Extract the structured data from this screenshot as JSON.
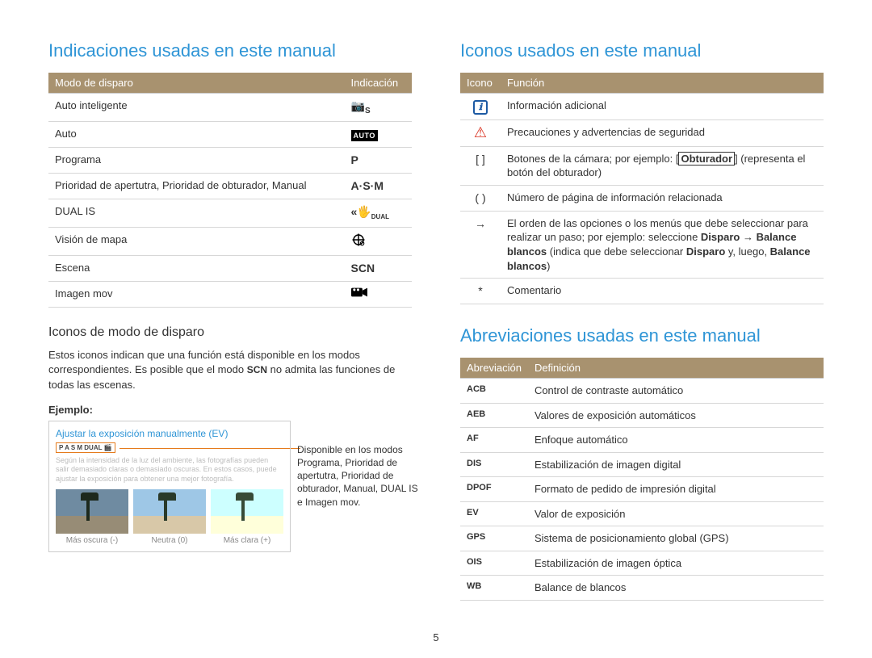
{
  "page_number": "5",
  "left": {
    "heading": "Indicaciones usadas en este manual",
    "table": {
      "header": [
        "Modo de disparo",
        "Indicación"
      ],
      "rows": [
        {
          "mode": "Auto inteligente",
          "ind": "S",
          "style": "smart"
        },
        {
          "mode": "Auto",
          "ind": "AUTO",
          "style": "autobox"
        },
        {
          "mode": "Programa",
          "ind": "P",
          "style": "plain"
        },
        {
          "mode": "Prioridad de apertutra, Prioridad de obturador, Manual",
          "ind": "A·S·M",
          "style": "plain"
        },
        {
          "mode": "DUAL IS",
          "ind": "DUAL",
          "style": "dual"
        },
        {
          "mode": "Visión de mapa",
          "ind": "⊕",
          "style": "plain"
        },
        {
          "mode": "Escena",
          "ind": "SCN",
          "style": "plain"
        },
        {
          "mode": "Imagen mov",
          "ind": "🎬",
          "style": "plain"
        }
      ]
    },
    "sub_heading": "Iconos de modo de disparo",
    "body_before_scn": "Estos iconos indican que una función está disponible en los modos correspondientes. Es posible que el modo ",
    "scn_inline": "SCN",
    "body_after_scn": " no admita las funciones de todas las escenas.",
    "ejemplo_label": "Ejemplo:",
    "example": {
      "title": "Ajustar la exposición manualmente (EV)",
      "mode_strip": "P A S M DUAL 🎬",
      "blurred_text": "Según la intensidad de la luz del ambiente, las fotografías pueden salir demasiado claras o demasiado oscuras. En estos casos, puede ajustar la exposición para obtener una mejor fotografía.",
      "thumbs": [
        "Más oscura (-)",
        "Neutra (0)",
        "Más clara (+)"
      ],
      "callout": "Disponible en los modos Programa, Prioridad de apertutra, Prioridad de obturador, Manual, DUAL IS e Imagen mov."
    }
  },
  "right": {
    "icons_heading": "Iconos usados en este manual",
    "icons_table": {
      "header": [
        "Icono",
        "Función"
      ],
      "rows": [
        {
          "icon": "info",
          "func": "Información adicional"
        },
        {
          "icon": "warn",
          "func": "Precauciones y advertencias de seguridad"
        },
        {
          "icon": "[ ]",
          "func_html": "Botones de la cámara; por ejemplo: [<b>Obturador</b>] (representa el botón del obturador)"
        },
        {
          "icon": "( )",
          "func": "Número de página de información relacionada"
        },
        {
          "icon": "→",
          "func_html": "El orden de las opciones o los menús que debe seleccionar para realizar un paso; por ejemplo: seleccione <b>Disparo</b> → <b>Balance blancos</b> (indica que debe seleccionar <b>Disparo</b> y, luego, <b>Balance blancos</b>)"
        },
        {
          "icon": "*",
          "func": "Comentario"
        }
      ]
    },
    "abbr_heading": "Abreviaciones usadas en este manual",
    "abbr_table": {
      "header": [
        "Abreviación",
        "Definición"
      ],
      "rows": [
        {
          "abbr": "ACB",
          "def": "Control de contraste automático"
        },
        {
          "abbr": "AEB",
          "def": "Valores de exposición automáticos"
        },
        {
          "abbr": "AF",
          "def": "Enfoque automático"
        },
        {
          "abbr": "DIS",
          "def": "Estabilización de imagen digital"
        },
        {
          "abbr": "DPOF",
          "def": "Formato de pedido de impresión digital"
        },
        {
          "abbr": "EV",
          "def": "Valor de exposición"
        },
        {
          "abbr": "GPS",
          "def": "Sistema de posicionamiento global (GPS)"
        },
        {
          "abbr": "OIS",
          "def": "Estabilización de imagen óptica"
        },
        {
          "abbr": "WB",
          "def": "Balance de blancos"
        }
      ]
    }
  }
}
